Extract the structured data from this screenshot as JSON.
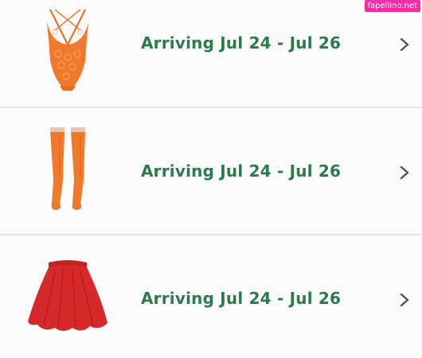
{
  "watermark": "fapellino.net",
  "orders": [
    {
      "eta": "Arriving Jul 24 - Jul 26",
      "image_icon": "orange-lace-bodysuit"
    },
    {
      "eta": "Arriving Jul 24 - Jul 26",
      "image_icon": "orange-thigh-high-stockings"
    },
    {
      "eta": "Arriving Jul 24 - Jul 26",
      "image_icon": "red-skater-skirt"
    }
  ],
  "colors": {
    "eta_text": "#2d7a4b",
    "chevron": "#555555",
    "divider": "#e6e6e6",
    "orange": "#f07a2c",
    "red": "#d62a2a",
    "watermark_bg": "#f02fa6"
  }
}
